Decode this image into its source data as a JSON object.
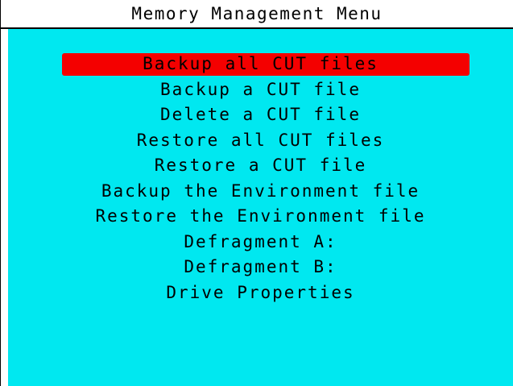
{
  "window": {
    "title": "Memory Management Menu"
  },
  "colors": {
    "menu_background": "#00e8f0",
    "selection_highlight": "#f40000",
    "text": "#000000"
  },
  "menu": {
    "selected_index": 0,
    "items": [
      {
        "label": "Backup all CUT files"
      },
      {
        "label": "Backup a CUT file"
      },
      {
        "label": "Delete a CUT file"
      },
      {
        "label": "Restore all CUT files"
      },
      {
        "label": "Restore a CUT file"
      },
      {
        "label": "Backup the Environment file"
      },
      {
        "label": "Restore the Environment file"
      },
      {
        "label": "Defragment A:"
      },
      {
        "label": "Defragment B:"
      },
      {
        "label": "Drive Properties"
      }
    ]
  }
}
